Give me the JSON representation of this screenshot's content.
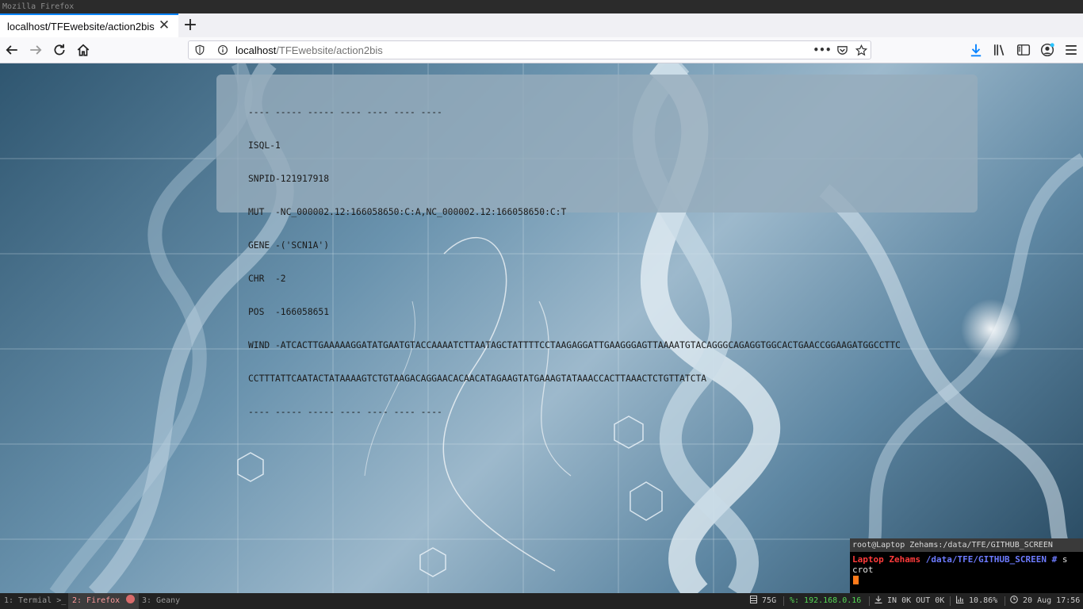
{
  "window_manager": {
    "title": "Mozilla Firefox"
  },
  "browser": {
    "tab_title": "localhost/TFEwebsite/action2bis",
    "tab_close": "✕",
    "new_tab": "+",
    "url_host": "localhost",
    "url_path": "/TFEwebsite/action2bis",
    "url_more": "•••"
  },
  "result": {
    "lines": [
      "---- ----- ----- ---- ---- ---- ----",
      "ISQL-1",
      "SNPID-121917918",
      "MUT  -NC_000002.12:166058650:C:A,NC_000002.12:166058650:C:T",
      "GENE -('SCN1A')",
      "CHR  -2",
      "POS  -166058651",
      "WIND -ATCACTTGAAAAAGGATATGAATGTACCAAAATCTTAATAGCTATTTTCCTAAGAGGATTGAAGGGAGTTAAAATGTACAGGGCAGAGGTGGCACTGAACCGGAAGATGGCCTTC",
      "CCTTTATTCAATACTATAAAAGTCTGTAAGACAGGAACACAACATAGAAGTATGAAAGTATAAACCACTTAAACTCTGTTATCTA",
      "---- ----- ----- ---- ---- ---- ----"
    ]
  },
  "terminal": {
    "title": "root@Laptop Zehams:/data/TFE/GITHUB_SCREEN",
    "prompt_host": "Laptop Zehams",
    "prompt_cwd": "/data/TFE/GITHUB_SCREEN",
    "prompt_symbol": "#",
    "command_start": "s",
    "command_rest": "crot"
  },
  "statusbar": {
    "workspaces": [
      {
        "label": "1: Termial >_",
        "active": false
      },
      {
        "label": "2: Firefox",
        "active": true
      },
      {
        "label": "3: Geany",
        "active": false
      }
    ],
    "disk": "75G",
    "ip": "%: 192.168.0.16",
    "net": "IN 0K OUT 0K",
    "cpu": "10.86%",
    "clock": "20 Aug 17:56"
  },
  "colors": {
    "tab_accent": "#0a84ff",
    "terminal_host": "#ff3b3b",
    "terminal_cwd": "#6d7bff",
    "status_green": "#55d955",
    "active_workspace": "#ff9a9a"
  },
  "icons": {
    "nav": [
      "back-arrow-icon",
      "forward-arrow-icon",
      "reload-icon",
      "home-icon"
    ],
    "url": [
      "tracking-shield-icon",
      "info-icon",
      "pocket-icon",
      "bookmark-star-icon"
    ],
    "toolbar": [
      "download-icon",
      "library-icon",
      "sidebar-icon",
      "account-icon",
      "hamburger-menu-icon"
    ]
  }
}
